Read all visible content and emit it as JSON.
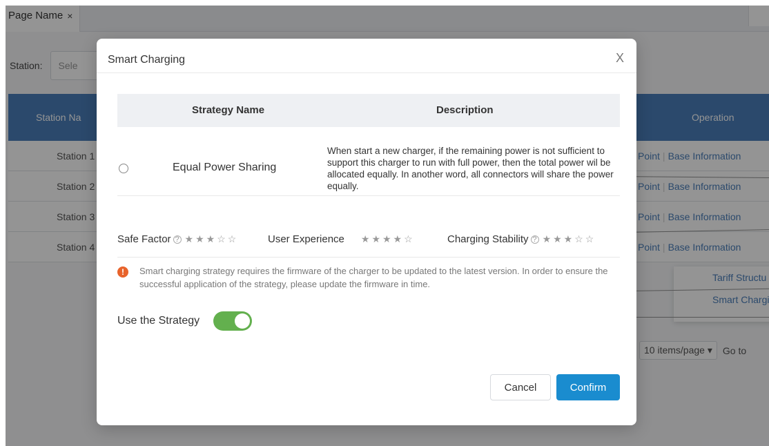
{
  "tab": {
    "label": "Page Name",
    "close": "×"
  },
  "filter": {
    "label": "Station:",
    "placeholder": "Sele"
  },
  "table": {
    "header_name": "Station Na",
    "header_op": "Operation",
    "rows": [
      {
        "name": "Station 1"
      },
      {
        "name": "Station 2"
      },
      {
        "name": "Station 3"
      },
      {
        "name": "Station 4"
      }
    ],
    "op_point": "Point",
    "op_base": "Base Information",
    "op_sep": "|"
  },
  "dropdown": {
    "item1": "Tariff Structu",
    "item2": "Smart Chargi"
  },
  "pager": {
    "size": "10 items/page",
    "caret": "▾",
    "goto": "Go to"
  },
  "modal": {
    "title": "Smart Charging",
    "close": "X",
    "col_name": "Strategy Name",
    "col_desc": "Description",
    "strategy": {
      "name": "Equal Power Sharing",
      "description": "When start a new charger, if the remaining power is not sufficient to support this charger to run with full power, then the total power wil be allocated equally. In another word, all connectors will share the power equally."
    },
    "ratings": {
      "safe_label": "Safe Factor",
      "safe_help": "?",
      "safe_stars": "★★★☆☆",
      "ux_label": "User Experience",
      "ux_stars": "★★★★☆",
      "stability_label": "Charging Stability",
      "stability_help": "?",
      "stability_stars": "★★★☆☆"
    },
    "notice": {
      "icon": "!",
      "text": "Smart charging strategy requires the firmware of the charger to be updated to the latest version. In order to ensure the successful application of the strategy, please update the firmware in time."
    },
    "use_label": "Use the Strategy",
    "toggle_on": true,
    "cancel": "Cancel",
    "confirm": "Confirm"
  },
  "colors": {
    "header_blue": "#4a7fba",
    "toggle_green": "#63b04e",
    "confirm_blue": "#1a8ccf",
    "warning_orange": "#e8632b"
  }
}
